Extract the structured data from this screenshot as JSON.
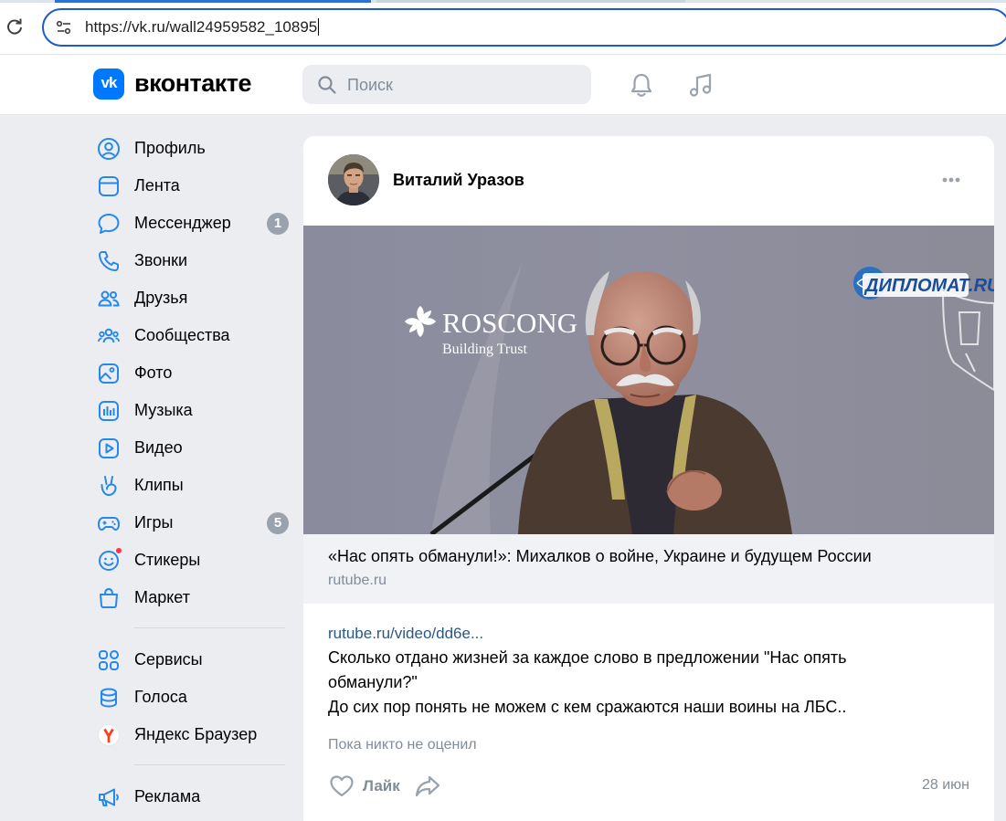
{
  "browser": {
    "url": "https://vk.ru/wall24959582_10895"
  },
  "header": {
    "brand_name": "вконтакте",
    "logo_text": "vk",
    "search_placeholder": "Поиск",
    "icons": [
      "bell-icon",
      "music-note-icon"
    ],
    "accent_color": "#0077ff"
  },
  "sidebar": {
    "items": [
      {
        "label": "Профиль",
        "icon": "profile-icon"
      },
      {
        "label": "Лента",
        "icon": "feed-icon"
      },
      {
        "label": "Мессенджер",
        "icon": "messenger-icon",
        "badge": "1"
      },
      {
        "label": "Звонки",
        "icon": "phone-icon"
      },
      {
        "label": "Друзья",
        "icon": "friends-icon"
      },
      {
        "label": "Сообщества",
        "icon": "communities-icon"
      },
      {
        "label": "Фото",
        "icon": "photo-icon"
      },
      {
        "label": "Музыка",
        "icon": "music-icon"
      },
      {
        "label": "Видео",
        "icon": "video-icon"
      },
      {
        "label": "Клипы",
        "icon": "clips-icon"
      },
      {
        "label": "Игры",
        "icon": "games-icon",
        "badge": "5"
      },
      {
        "label": "Стикеры",
        "icon": "stickers-icon"
      },
      {
        "label": "Маркет",
        "icon": "market-icon"
      }
    ],
    "items2": [
      {
        "label": "Сервисы",
        "icon": "services-icon"
      },
      {
        "label": "Голоса",
        "icon": "votes-icon"
      },
      {
        "label": "Яндекс Браузер",
        "icon": "yandex-browser-icon"
      }
    ],
    "items3": [
      {
        "label": "Реклама",
        "icon": "megaphone-icon"
      }
    ]
  },
  "post": {
    "author": "Виталий Уразов",
    "media": {
      "logo_text": "ROSCONG",
      "logo_subtext": "Building Trust",
      "watermark": "ДИПЛОМАТ.RU"
    },
    "snippet_title": "«Нас опять обманули!»: Михалков о войне, Украине и будущем России",
    "snippet_domain": "rutube.ru",
    "link_text": "rutube.ru/video/dd6e...",
    "text_lines": [
      "Сколько отдано жизней за каждое слово в предложении \"Нас опять",
      "обманули?\"",
      "До сих пор понять не можем с кем сражаются наши воины на ЛБС.."
    ],
    "likes_status": "Пока никто не оценил",
    "like_label": "Лайк",
    "date": "28 июн"
  }
}
